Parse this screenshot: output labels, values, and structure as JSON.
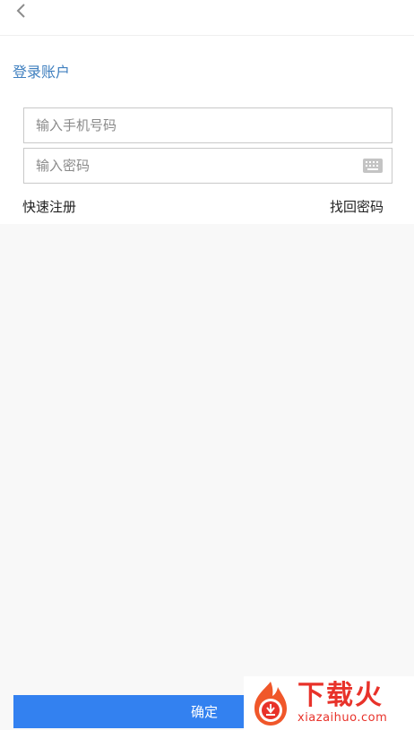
{
  "header": {
    "back_icon": "chevron-left-icon"
  },
  "login": {
    "title": "登录账户",
    "phone_placeholder": "输入手机号码",
    "password_placeholder": "输入密码",
    "keyboard_icon": "keyboard-icon",
    "register_link": "快速注册",
    "forgot_link": "找回密码",
    "confirm_button": "确定"
  },
  "watermark": {
    "brand": "下载火",
    "domain": "xiazaihuo.com"
  },
  "colors": {
    "accent_blue": "#3381f0",
    "title_blue": "#3f7fbf",
    "background": "#f8f8f8",
    "watermark_red": "#e8322a"
  }
}
